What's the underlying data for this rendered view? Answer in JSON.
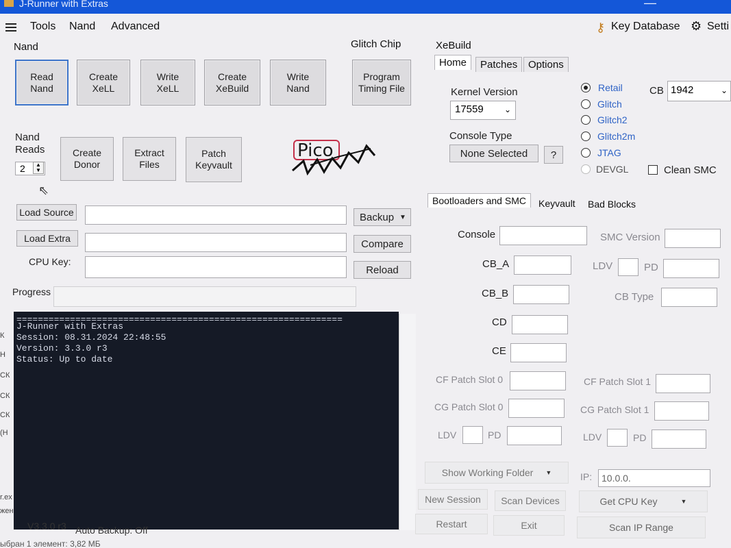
{
  "window": {
    "title": "J-Runner with Extras",
    "minimize": "—"
  },
  "menu": {
    "tools": "Tools",
    "nand": "Nand",
    "advanced": "Advanced",
    "key_database": "Key Database",
    "settings": "Setti"
  },
  "nand_group": {
    "title": "Nand",
    "buttons": {
      "read_nand": "Read\nNand",
      "create_xell": "Create\nXeLL",
      "write_xell": "Write\nXeLL",
      "create_xebuild": "Create\nXeBuild",
      "write_nand": "Write\nNand"
    },
    "nand_reads_label": "Nand\nReads",
    "nand_reads_value": "2",
    "create_donor": "Create\nDonor",
    "extract_files": "Extract\nFiles",
    "patch_keyvault": "Patch\nKeyvault"
  },
  "glitch_chip": {
    "title": "Glitch Chip",
    "program_timing": "Program\nTiming File"
  },
  "logo": {
    "pico": "Pico"
  },
  "source": {
    "load_source": "Load Source",
    "load_extra": "Load Extra",
    "cpu_key": "CPU Key:",
    "backup": "Backup",
    "compare": "Compare",
    "reload": "Reload",
    "progress": "Progress"
  },
  "console": {
    "lines": [
      "=============================================================",
      "J-Runner with Extras",
      "Session: 08.31.2024 22:48:55",
      "Version: 3.3.0 r3",
      "Status: Up to date"
    ]
  },
  "status_bar": {
    "version": "V3.3.0 r3",
    "auto_backup": "Auto Backup: Off",
    "footer": "ыбран 1 элемент: 3,82 МБ"
  },
  "left_strip": {
    "items": [
      "К",
      "Н",
      "СК",
      "СК",
      "СК",
      "(Н",
      "r.ex",
      "жен"
    ]
  },
  "xebuild": {
    "title": "XeBuild",
    "tabs": [
      "Home",
      "Patches",
      "Options"
    ],
    "kernel_version_label": "Kernel Version",
    "kernel_version": "17559",
    "console_type_label": "Console Type",
    "console_type": "None Selected",
    "help": "?",
    "radios": [
      "Retail",
      "Glitch",
      "Glitch2",
      "Glitch2m",
      "JTAG",
      "DEVGL"
    ],
    "cb_label": "CB",
    "cb_value": "1942",
    "clean_smc": "Clean SMC"
  },
  "boot": {
    "tabs": [
      "Bootloaders and SMC",
      "Keyvault",
      "Bad Blocks"
    ],
    "console": "Console",
    "smc_version": "SMC Version",
    "cb_a": "CB_A",
    "cb_b": "CB_B",
    "ldv": "LDV",
    "pd": "PD",
    "cb_type": "CB Type",
    "cd": "CD",
    "ce": "CE",
    "cf_slot0": "CF Patch Slot 0",
    "cf_slot1": "CF Patch Slot 1",
    "cg_slot0": "CG Patch Slot 0",
    "cg_slot1": "CG Patch Slot 1"
  },
  "bottom_right": {
    "show_working_folder": "Show Working Folder",
    "ip_label": "IP:",
    "ip_value": "10.0.0.",
    "new_session": "New Session",
    "scan_devices": "Scan Devices",
    "get_cpu_key": "Get CPU Key",
    "restart": "Restart",
    "exit": "Exit",
    "scan_ip_range": "Scan IP Range"
  }
}
